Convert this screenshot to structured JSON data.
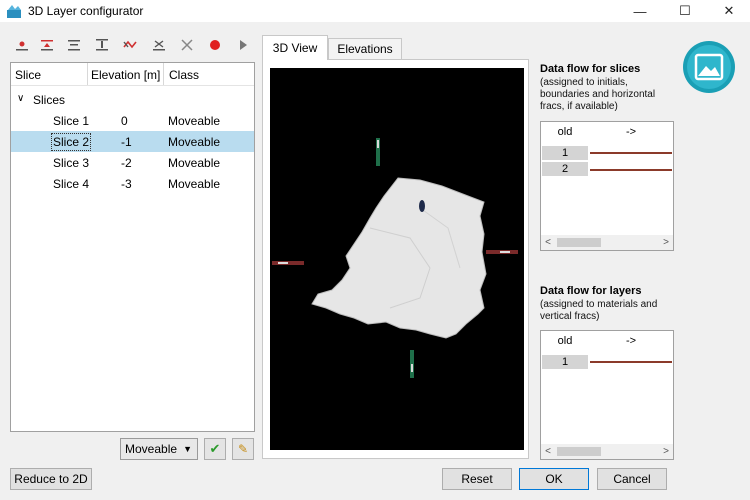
{
  "window": {
    "title": "3D Layer configurator",
    "minimize_glyph": "—",
    "maximize_glyph": "☐",
    "close_glyph": "✕"
  },
  "toolbar": {
    "icons": [
      "add-slice-icon",
      "insert-slice-above-icon",
      "insert-slice-between-icon",
      "insert-slice-below-icon",
      "flip-slices-icon",
      "merge-slices-icon",
      "delete-icon",
      "record-icon",
      "play-icon"
    ]
  },
  "table": {
    "headers": {
      "slice": "Slice",
      "elevation": "Elevation [m]",
      "class": "Class"
    },
    "group": {
      "expander": "∨",
      "label": "Slices"
    },
    "rows": [
      {
        "slice": "Slice 1",
        "elevation": "0",
        "class": "Moveable"
      },
      {
        "slice": "Slice 2",
        "elevation": "-1",
        "class": "Moveable"
      },
      {
        "slice": "Slice 3",
        "elevation": "-2",
        "class": "Moveable"
      },
      {
        "slice": "Slice 4",
        "elevation": "-3",
        "class": "Moveable"
      }
    ],
    "selected_row": 1
  },
  "class_select": {
    "value": "Moveable",
    "arrow": "▼"
  },
  "apply_glyph": "✔",
  "edit_glyph": "✎",
  "buttons": {
    "reduce": "Reduce to 2D",
    "reset": "Reset",
    "ok": "OK",
    "cancel": "Cancel"
  },
  "tabs": [
    {
      "label": "3D View",
      "active": true
    },
    {
      "label": "Elevations",
      "active": false
    }
  ],
  "slices_flow": {
    "title": "Data flow for slices",
    "subtitle_lines": [
      "(assigned to initials,",
      "boundaries and horizontal",
      "fracs, if available)"
    ],
    "col_old": "old",
    "col_arrow": "->",
    "rows": [
      "1",
      "2"
    ]
  },
  "layers_flow": {
    "title": "Data flow for layers",
    "subtitle_lines": [
      "(assigned to materials and",
      "vertical fracs)"
    ],
    "col_old": "old",
    "col_arrow": "->",
    "rows": [
      "1"
    ]
  },
  "scroll_glyphs": {
    "left": "<",
    "right": ">"
  },
  "colors": {
    "selection": "#b9dcef",
    "flow_line": "#8b3a2a",
    "accent_teal": "#1a9fb5",
    "viewport_bg": "#000000"
  }
}
